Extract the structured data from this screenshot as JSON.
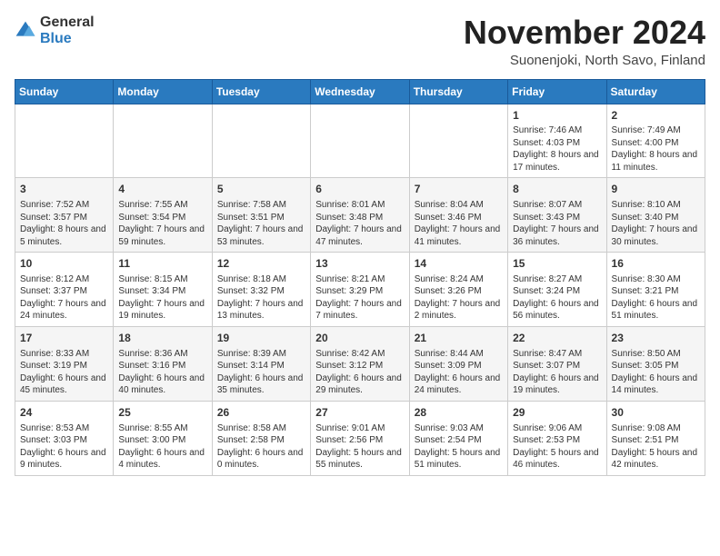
{
  "logo": {
    "general": "General",
    "blue": "Blue"
  },
  "title": "November 2024",
  "location": "Suonenjoki, North Savo, Finland",
  "days_of_week": [
    "Sunday",
    "Monday",
    "Tuesday",
    "Wednesday",
    "Thursday",
    "Friday",
    "Saturday"
  ],
  "weeks": [
    [
      {
        "day": "",
        "info": ""
      },
      {
        "day": "",
        "info": ""
      },
      {
        "day": "",
        "info": ""
      },
      {
        "day": "",
        "info": ""
      },
      {
        "day": "",
        "info": ""
      },
      {
        "day": "1",
        "info": "Sunrise: 7:46 AM\nSunset: 4:03 PM\nDaylight: 8 hours and 17 minutes."
      },
      {
        "day": "2",
        "info": "Sunrise: 7:49 AM\nSunset: 4:00 PM\nDaylight: 8 hours and 11 minutes."
      }
    ],
    [
      {
        "day": "3",
        "info": "Sunrise: 7:52 AM\nSunset: 3:57 PM\nDaylight: 8 hours and 5 minutes."
      },
      {
        "day": "4",
        "info": "Sunrise: 7:55 AM\nSunset: 3:54 PM\nDaylight: 7 hours and 59 minutes."
      },
      {
        "day": "5",
        "info": "Sunrise: 7:58 AM\nSunset: 3:51 PM\nDaylight: 7 hours and 53 minutes."
      },
      {
        "day": "6",
        "info": "Sunrise: 8:01 AM\nSunset: 3:48 PM\nDaylight: 7 hours and 47 minutes."
      },
      {
        "day": "7",
        "info": "Sunrise: 8:04 AM\nSunset: 3:46 PM\nDaylight: 7 hours and 41 minutes."
      },
      {
        "day": "8",
        "info": "Sunrise: 8:07 AM\nSunset: 3:43 PM\nDaylight: 7 hours and 36 minutes."
      },
      {
        "day": "9",
        "info": "Sunrise: 8:10 AM\nSunset: 3:40 PM\nDaylight: 7 hours and 30 minutes."
      }
    ],
    [
      {
        "day": "10",
        "info": "Sunrise: 8:12 AM\nSunset: 3:37 PM\nDaylight: 7 hours and 24 minutes."
      },
      {
        "day": "11",
        "info": "Sunrise: 8:15 AM\nSunset: 3:34 PM\nDaylight: 7 hours and 19 minutes."
      },
      {
        "day": "12",
        "info": "Sunrise: 8:18 AM\nSunset: 3:32 PM\nDaylight: 7 hours and 13 minutes."
      },
      {
        "day": "13",
        "info": "Sunrise: 8:21 AM\nSunset: 3:29 PM\nDaylight: 7 hours and 7 minutes."
      },
      {
        "day": "14",
        "info": "Sunrise: 8:24 AM\nSunset: 3:26 PM\nDaylight: 7 hours and 2 minutes."
      },
      {
        "day": "15",
        "info": "Sunrise: 8:27 AM\nSunset: 3:24 PM\nDaylight: 6 hours and 56 minutes."
      },
      {
        "day": "16",
        "info": "Sunrise: 8:30 AM\nSunset: 3:21 PM\nDaylight: 6 hours and 51 minutes."
      }
    ],
    [
      {
        "day": "17",
        "info": "Sunrise: 8:33 AM\nSunset: 3:19 PM\nDaylight: 6 hours and 45 minutes."
      },
      {
        "day": "18",
        "info": "Sunrise: 8:36 AM\nSunset: 3:16 PM\nDaylight: 6 hours and 40 minutes."
      },
      {
        "day": "19",
        "info": "Sunrise: 8:39 AM\nSunset: 3:14 PM\nDaylight: 6 hours and 35 minutes."
      },
      {
        "day": "20",
        "info": "Sunrise: 8:42 AM\nSunset: 3:12 PM\nDaylight: 6 hours and 29 minutes."
      },
      {
        "day": "21",
        "info": "Sunrise: 8:44 AM\nSunset: 3:09 PM\nDaylight: 6 hours and 24 minutes."
      },
      {
        "day": "22",
        "info": "Sunrise: 8:47 AM\nSunset: 3:07 PM\nDaylight: 6 hours and 19 minutes."
      },
      {
        "day": "23",
        "info": "Sunrise: 8:50 AM\nSunset: 3:05 PM\nDaylight: 6 hours and 14 minutes."
      }
    ],
    [
      {
        "day": "24",
        "info": "Sunrise: 8:53 AM\nSunset: 3:03 PM\nDaylight: 6 hours and 9 minutes."
      },
      {
        "day": "25",
        "info": "Sunrise: 8:55 AM\nSunset: 3:00 PM\nDaylight: 6 hours and 4 minutes."
      },
      {
        "day": "26",
        "info": "Sunrise: 8:58 AM\nSunset: 2:58 PM\nDaylight: 6 hours and 0 minutes."
      },
      {
        "day": "27",
        "info": "Sunrise: 9:01 AM\nSunset: 2:56 PM\nDaylight: 5 hours and 55 minutes."
      },
      {
        "day": "28",
        "info": "Sunrise: 9:03 AM\nSunset: 2:54 PM\nDaylight: 5 hours and 51 minutes."
      },
      {
        "day": "29",
        "info": "Sunrise: 9:06 AM\nSunset: 2:53 PM\nDaylight: 5 hours and 46 minutes."
      },
      {
        "day": "30",
        "info": "Sunrise: 9:08 AM\nSunset: 2:51 PM\nDaylight: 5 hours and 42 minutes."
      }
    ]
  ]
}
